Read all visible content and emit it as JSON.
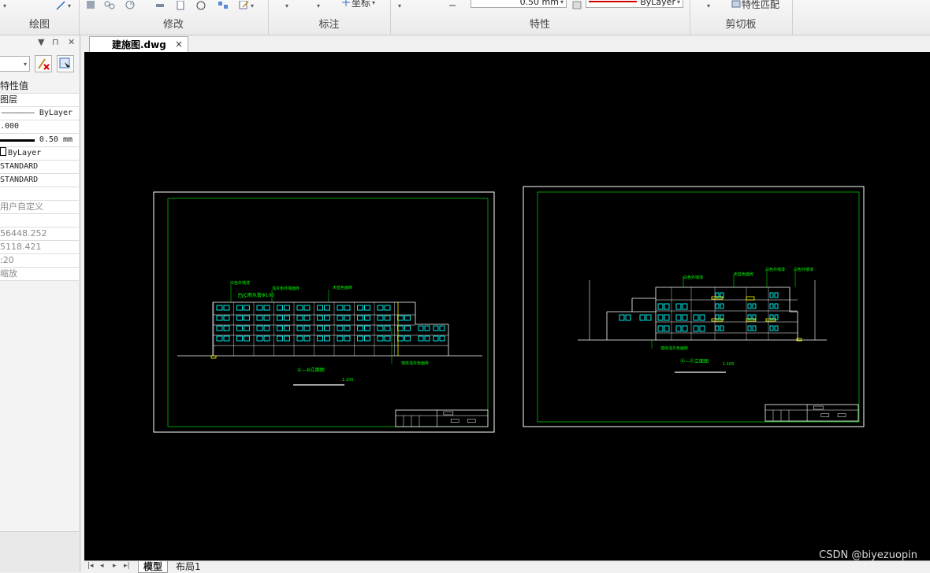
{
  "ribbon": {
    "groups": [
      {
        "label": "绘图"
      },
      {
        "label": "修改"
      },
      {
        "label": "标注"
      },
      {
        "label": "特性"
      },
      {
        "label": "剪切板"
      }
    ],
    "lineweight_value": "0.50 mm",
    "color_value": "ByLayer",
    "coord_label": "坐标",
    "match_props_label": "特性匹配"
  },
  "palette": {
    "header_label": "特性值",
    "rows": [
      {
        "text": "图层",
        "style": "plain"
      },
      {
        "text": "——————— ByLayer",
        "style": "mono"
      },
      {
        "text": ".000",
        "style": "mono"
      },
      {
        "text": "0.50 mm",
        "style": "mono",
        "thick": true
      },
      {
        "text": "ByLayer",
        "style": "mono",
        "box": true
      },
      {
        "text": "STANDARD",
        "style": "mono"
      },
      {
        "text": "STANDARD",
        "style": "mono"
      },
      {
        "text": "",
        "style": "plain"
      },
      {
        "text": "用户自定义",
        "style": "grey"
      },
      {
        "text": "",
        "style": "plain"
      },
      {
        "text": "56448.252",
        "style": "grey"
      },
      {
        "text": "5118.421",
        "style": "grey"
      },
      {
        "text": ":20",
        "style": "grey"
      },
      {
        "text": "缩放",
        "style": "grey"
      }
    ]
  },
  "document": {
    "tab_label": "建施图.dwg",
    "close_glyph": "×"
  },
  "drawing": {
    "sheet1": {
      "annotations": [
        "白色外墙漆",
        "PVC雨水管Φ100",
        "浅灰色外墙面砖",
        "天蓝色面砖",
        "墙体浅灰色面砖"
      ],
      "title": "①—⑩立面图",
      "scale": "1:100"
    },
    "sheet2": {
      "annotations": [
        "白色外墙漆",
        "天蓝色面砖",
        "白色外墙漆",
        "白色外墙漆"
      ],
      "bottom_note": "墙体浅灰色面砖",
      "title": "Ⓐ—Ⓖ立面图",
      "scale": "1:100"
    },
    "colors": {
      "frame": "#ffffff",
      "inner": "#00c000",
      "building": "#ffffff",
      "window": "#00ffff",
      "note": "#ffff00",
      "text": "#00ff00"
    }
  },
  "bottom": {
    "tabs": [
      {
        "label": "模型",
        "active": true
      },
      {
        "label": "布局1",
        "active": false
      }
    ],
    "nav": [
      "|◂",
      "◂",
      "▸",
      "▸|"
    ]
  },
  "watermark": "CSDN @biyezuopin"
}
